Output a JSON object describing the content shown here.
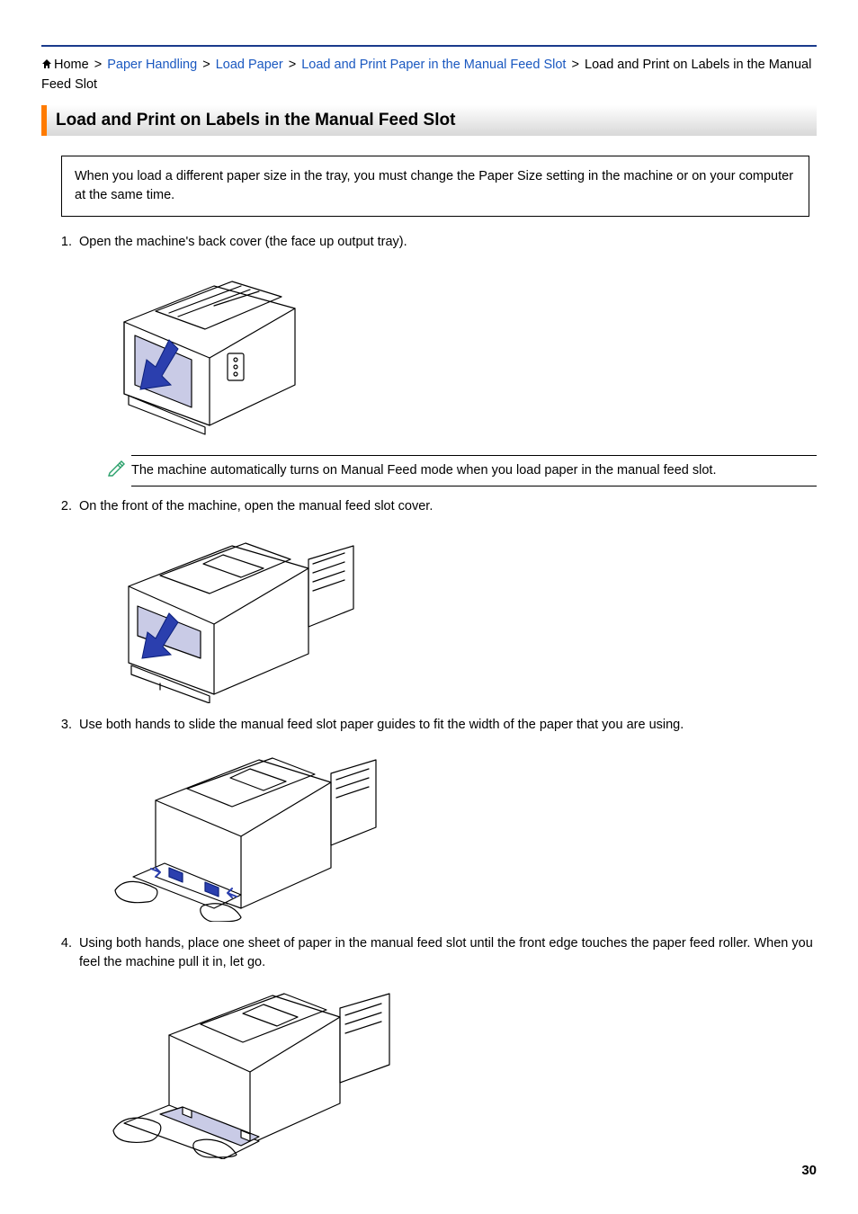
{
  "breadcrumb": {
    "home": "Home",
    "items": [
      "Paper Handling",
      "Load Paper",
      "Load and Print Paper in the Manual Feed Slot"
    ],
    "current": "Load and Print on Labels in the Manual Feed Slot"
  },
  "title": "Load and Print on Labels in the Manual Feed Slot",
  "infobox": "When you load a different paper size in the tray, you must change the Paper Size setting in the machine or on your computer at the same time.",
  "steps": {
    "s1": "Open the machine's back cover (the face up output tray).",
    "s1_note": "The machine automatically turns on Manual Feed mode when you load paper in the manual feed slot.",
    "s2": "On the front of the machine, open the manual feed slot cover.",
    "s3": "Use both hands to slide the manual feed slot paper guides to fit the width of the paper that you are using.",
    "s4": "Using both hands, place one sheet of paper in the manual feed slot until the front edge touches the paper feed roller. When you feel the machine pull it in, let go."
  },
  "page_number": "30"
}
